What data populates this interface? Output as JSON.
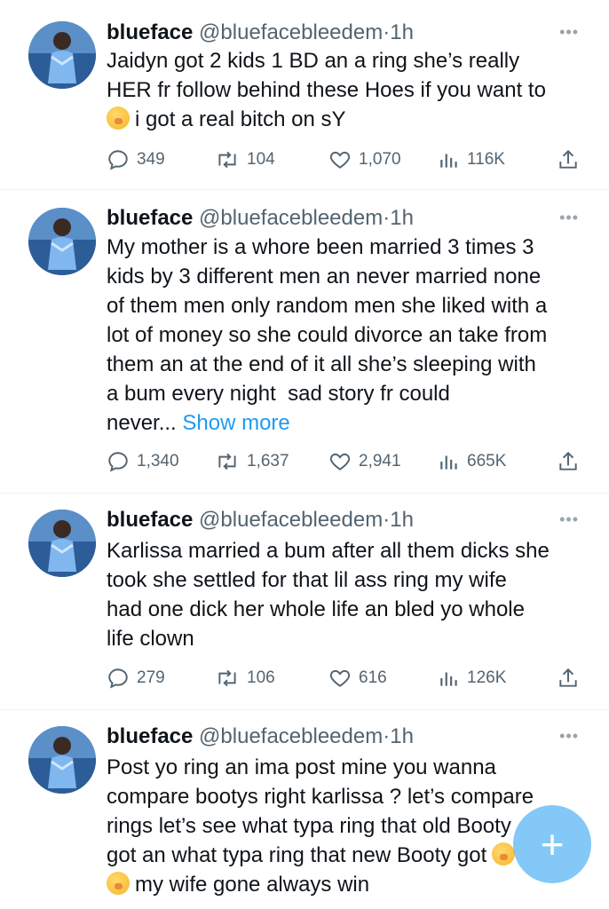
{
  "tweets": [
    {
      "name": "blueface",
      "handle": "@bluefacebleedem",
      "sep": "·",
      "time": "1h",
      "lines": [
        "Jaidyn got 2 kids 1 BD an a ring she’s really",
        "HER fr follow behind these Hoes if you want to",
        "i got a real bitch on sY"
      ],
      "show_more": "",
      "replies": "349",
      "reposts": "104",
      "likes": "1,070",
      "views": "116K"
    },
    {
      "name": "blueface",
      "handle": "@bluefacebleedem",
      "sep": "·",
      "time": "1h",
      "lines": [
        "My mother is a whore been married 3 times 3",
        "kids by 3 different men an never married none",
        "of them men only random men she liked with a",
        "lot of money so she could divorce an take from",
        "them an at the end of it all she’s sleeping with",
        "a bum every night  sad story fr could",
        "never... "
      ],
      "show_more": "Show more",
      "replies": "1,340",
      "reposts": "1,637",
      "likes": "2,941",
      "views": "665K"
    },
    {
      "name": "blueface",
      "handle": "@bluefacebleedem",
      "sep": "·",
      "time": "1h",
      "lines": [
        "Karlissa married a bum after all them dicks she",
        "took she settled for that lil ass ring my wife",
        "had one dick her whole life an bled yo whole",
        "life clown"
      ],
      "show_more": "",
      "replies": "279",
      "reposts": "106",
      "likes": "616",
      "views": "126K"
    },
    {
      "name": "blueface",
      "handle": "@bluefacebleedem",
      "sep": "·",
      "time": "1h",
      "lines": [
        "Post yo ring an ima post mine you wanna",
        "compare bootys right karlissa ? let’s compare",
        "rings let’s see what typa ring that old Booty",
        "got an what typa ring that new Booty got",
        "my wife gone always win"
      ],
      "show_more": "",
      "replies": "",
      "reposts": "",
      "likes": "",
      "views": ""
    }
  ],
  "fab": {
    "label": "+",
    "icon": "plus-icon"
  },
  "colors": {
    "accent": "#1d9bf0",
    "muted": "#536471",
    "text": "#0f1419"
  }
}
